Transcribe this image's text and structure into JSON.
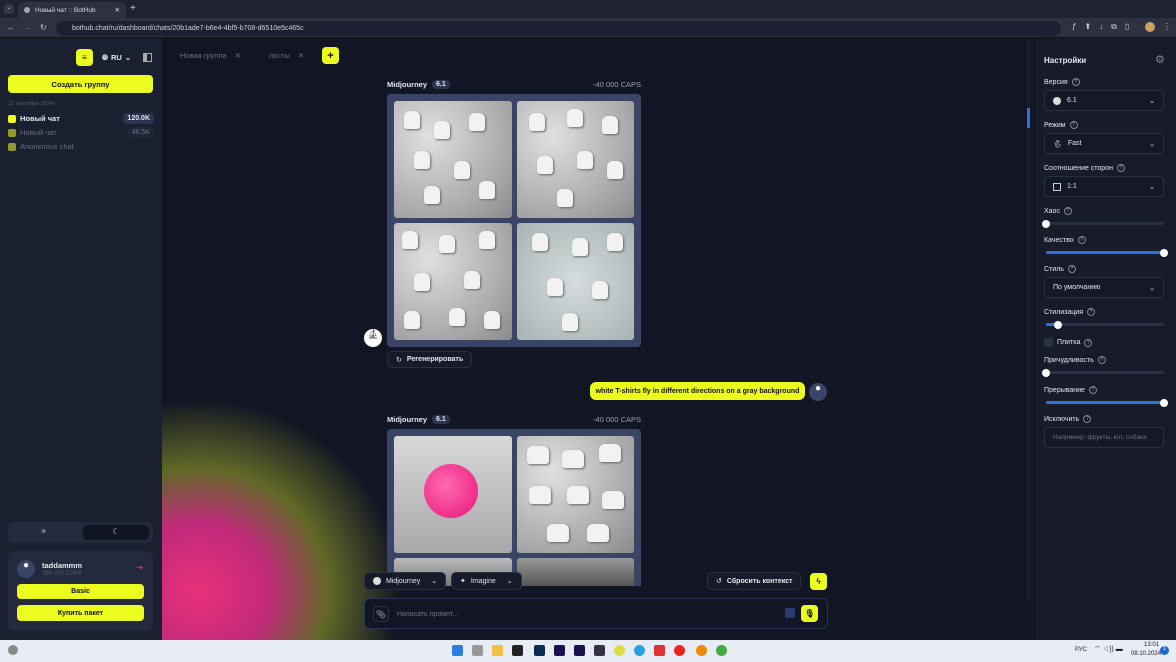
{
  "browser": {
    "tab_title": "Новый чат :: BotHub",
    "url": "bothub.chat/ru/dashboard/chats/20b1ade7-b6e4-4bf5-b708-d6510e5c465c"
  },
  "sidebar": {
    "lang": "RU",
    "create_group": "Создать группу",
    "date": "12 сентября 2024 г.",
    "chats": [
      {
        "name": "Новый чат",
        "count": "120.0K"
      },
      {
        "name": "Новый чат",
        "count": "46.5K"
      },
      {
        "name": "Anonimous chat",
        "count": ""
      }
    ],
    "user": {
      "name": "taddammm",
      "caps": "399 759 CAPS"
    },
    "plan": "Basic",
    "buy": "Купить пакет"
  },
  "tabs": [
    {
      "label": "Новая группа"
    },
    {
      "label": "посты"
    }
  ],
  "messages": [
    {
      "model": "Midjourney",
      "version": "6.1",
      "caps": "-40 000 CAPS",
      "regen": "Регенерировать"
    },
    {
      "user_text": "white T-shirts fly in different directions on a gray background"
    },
    {
      "model": "Midjourney",
      "version": "6.1",
      "caps": "-40 000 CAPS"
    }
  ],
  "composer": {
    "model": "Midjourney",
    "mode": "Imagine",
    "reset": "Сбросить контекст",
    "placeholder": "Написать промпт..."
  },
  "settings": {
    "title": "Настройки",
    "version_label": "Версия",
    "version": "6.1",
    "mode_label": "Режим",
    "mode": "Fast",
    "aspect_label": "Соотношение сторон",
    "aspect": "1:1",
    "chaos_label": "Хаос",
    "chaos": 0,
    "quality_label": "Качество",
    "quality": 1,
    "style_label": "Стиль",
    "style": "По умолчанию",
    "stylize_label": "Стилизация",
    "stylize": 0.1,
    "tile_label": "Плитка",
    "weird_label": "Причудливость",
    "weird": 0,
    "stop_label": "Прерывание",
    "stop": 1,
    "exclude_label": "Исключить",
    "exclude_placeholder": "Например: фрукты, кот, собака"
  },
  "taskbar": {
    "lang": "РУС",
    "time": "13:01",
    "date": "08.10.2024",
    "notif": "1"
  }
}
